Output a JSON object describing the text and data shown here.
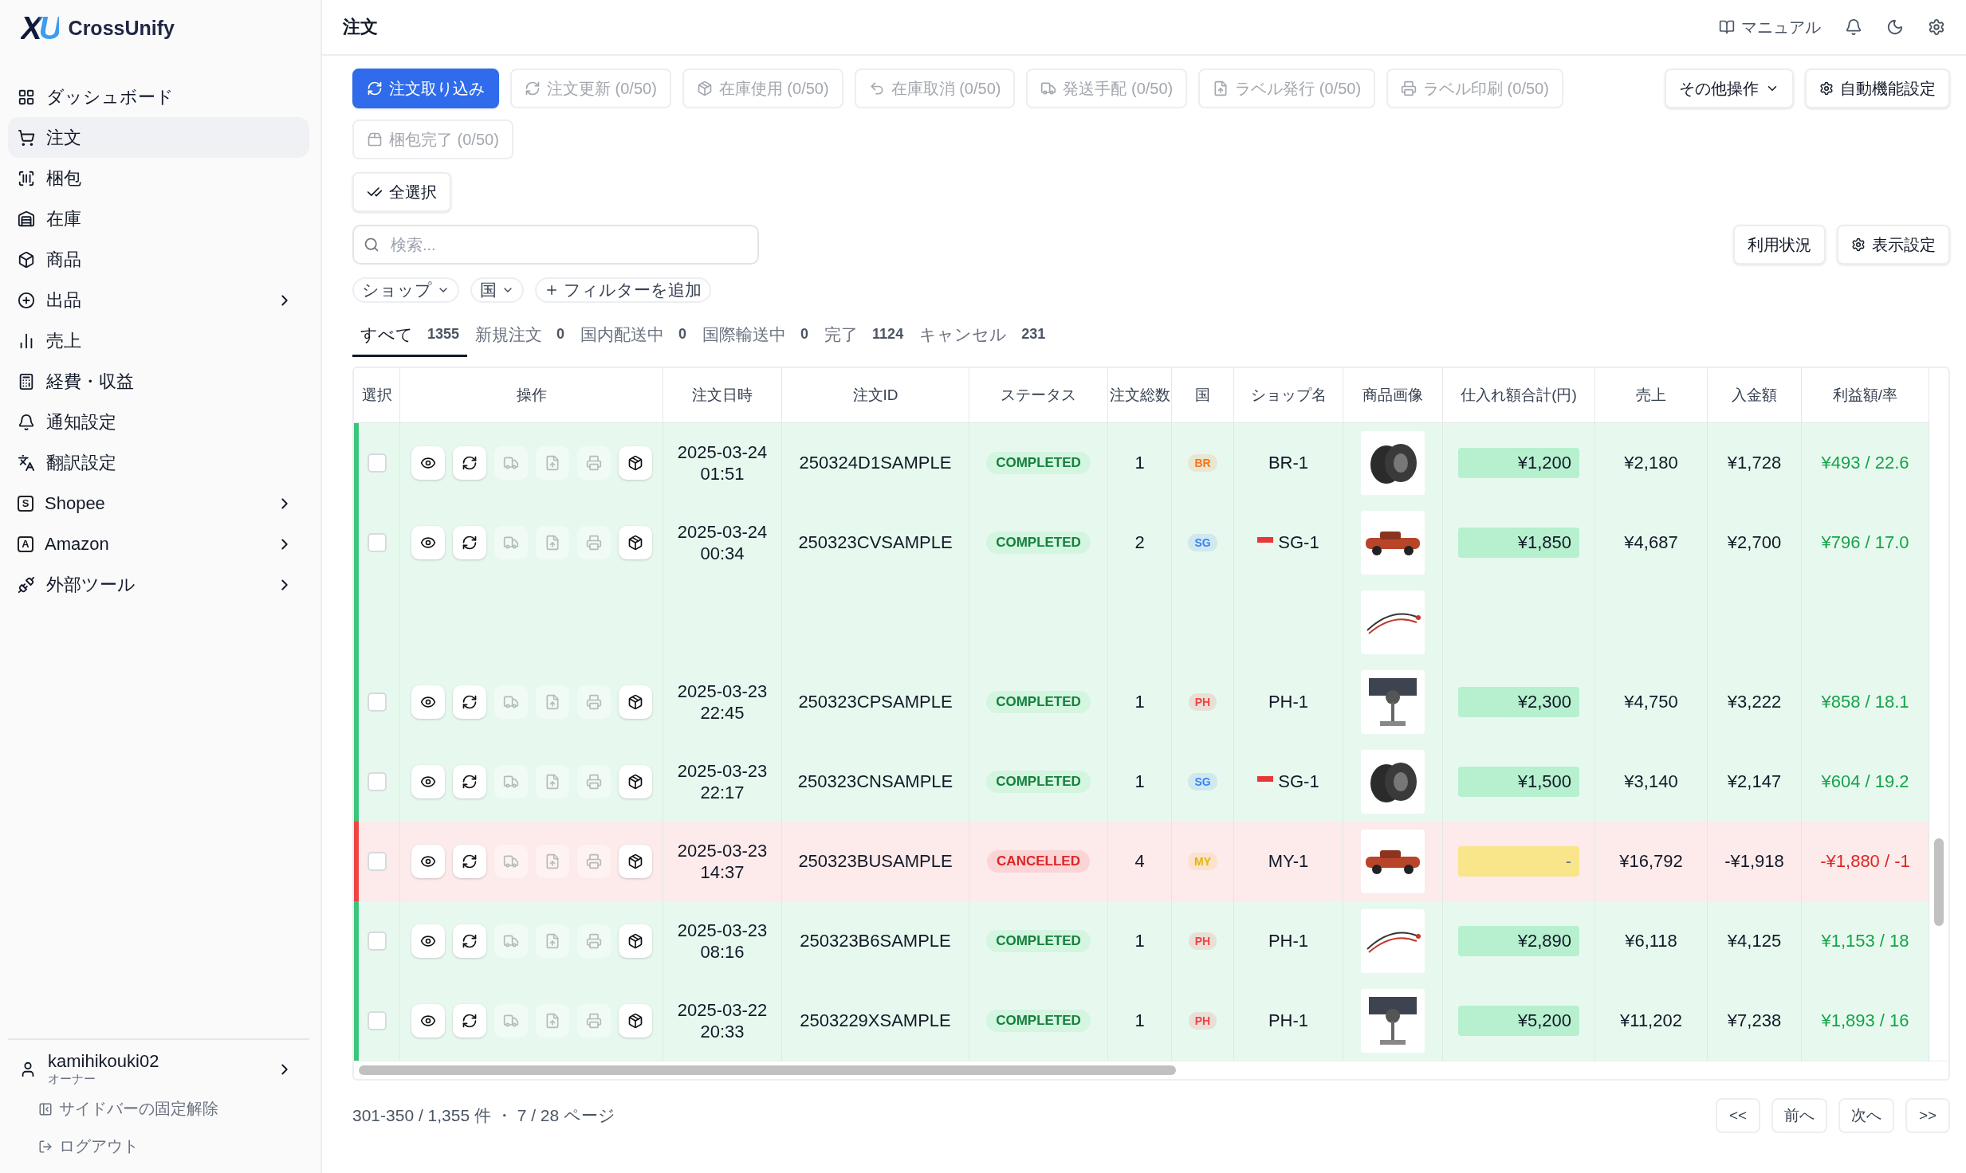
{
  "logo": {
    "mark": "XU",
    "name": "CrossUnify"
  },
  "sidebar": {
    "items": [
      {
        "label": "ダッシュボード",
        "expandable": false,
        "selected": false
      },
      {
        "label": "注文",
        "expandable": false,
        "selected": true
      },
      {
        "label": "梱包",
        "expandable": false,
        "selected": false
      },
      {
        "label": "在庫",
        "expandable": false,
        "selected": false
      },
      {
        "label": "商品",
        "expandable": false,
        "selected": false
      },
      {
        "label": "出品",
        "expandable": true,
        "selected": false
      },
      {
        "label": "売上",
        "expandable": false,
        "selected": false
      },
      {
        "label": "経費・収益",
        "expandable": false,
        "selected": false
      },
      {
        "label": "通知設定",
        "expandable": false,
        "selected": false
      },
      {
        "label": "翻訳設定",
        "expandable": false,
        "selected": false
      },
      {
        "label": "Shopee",
        "icon_letter": "S",
        "expandable": true,
        "selected": false
      },
      {
        "label": "Amazon",
        "icon_letter": "A",
        "expandable": true,
        "selected": false
      },
      {
        "label": "外部ツール",
        "expandable": true,
        "selected": false
      }
    ],
    "user": {
      "name": "kamihikouki02",
      "role": "オーナー"
    },
    "unpin": "サイドバーの固定解除",
    "logout": "ログアウト"
  },
  "header": {
    "title": "注文",
    "manual": "マニュアル"
  },
  "toolbar": [
    {
      "label": "注文取り込み",
      "kind": "primary",
      "disabled": false
    },
    {
      "label": "注文更新 (0/50)",
      "kind": "action",
      "disabled": true
    },
    {
      "label": "在庫使用 (0/50)",
      "kind": "action",
      "disabled": true
    },
    {
      "label": "在庫取消 (0/50)",
      "kind": "action",
      "disabled": true
    },
    {
      "label": "発送手配 (0/50)",
      "kind": "action",
      "disabled": true
    },
    {
      "label": "ラベル発行 (0/50)",
      "kind": "action",
      "disabled": true
    },
    {
      "label": "ラベル印刷 (0/50)",
      "kind": "action",
      "disabled": true
    },
    {
      "label": "梱包完了 (0/50)",
      "kind": "action",
      "disabled": true
    }
  ],
  "more_actions": "その他操作",
  "auto_settings": "自動機能設定",
  "select_all": "全選択",
  "search": {
    "placeholder": "検索..."
  },
  "usage": "利用状況",
  "display_settings": "表示設定",
  "filters": [
    {
      "label": "ショップ"
    },
    {
      "label": "国"
    }
  ],
  "add_filter": "フィルターを追加",
  "tabs": [
    {
      "label": "すべて",
      "count": "1355",
      "selected": true
    },
    {
      "label": "新規注文",
      "count": "0",
      "selected": false
    },
    {
      "label": "国内配送中",
      "count": "0",
      "selected": false
    },
    {
      "label": "国際輸送中",
      "count": "0",
      "selected": false
    },
    {
      "label": "完了",
      "count": "1124",
      "selected": false
    },
    {
      "label": "キャンセル",
      "count": "231",
      "selected": false
    }
  ],
  "table": {
    "columns": [
      "選択",
      "操作",
      "注文日時",
      "注文ID",
      "ステータス",
      "注文総数",
      "国",
      "ショップ名",
      "商品画像",
      "仕入れ額合計(円)",
      "売上",
      "入金額",
      "利益額/率"
    ],
    "row_actions": [
      {
        "enabled": true
      },
      {
        "enabled": true
      },
      {
        "enabled": false
      },
      {
        "enabled": false
      },
      {
        "enabled": false
      },
      {
        "enabled": true
      }
    ],
    "rows": [
      {
        "selected": false,
        "date": "2025-03-24",
        "time": "01:51",
        "id": "250324D1SAMPLE",
        "status": "COMPLETED",
        "cancelled": false,
        "qty": "1",
        "country": {
          "code": "BR",
          "color": "#f97316"
        },
        "shop": {
          "name": "BR-1",
          "flag": false
        },
        "cost": "¥1,200",
        "sales": "¥2,180",
        "deposit": "¥1,728",
        "profit": "¥493 / 22.6"
      },
      {
        "selected": false,
        "date": "2025-03-24",
        "time": "00:34",
        "id": "250323CVSAMPLE",
        "status": "COMPLETED",
        "cancelled": false,
        "qty": "2",
        "country": {
          "code": "SG",
          "color": "#3b82f6"
        },
        "shop": {
          "name": "SG-1",
          "flag": true
        },
        "cost": "¥1,850",
        "sales": "¥4,687",
        "deposit": "¥2,700",
        "profit": "¥796 / 17.0"
      },
      {
        "selected": false,
        "date": "2025-03-23",
        "time": "22:45",
        "id": "250323CPSAMPLE",
        "status": "COMPLETED",
        "cancelled": false,
        "qty": "1",
        "country": {
          "code": "PH",
          "color": "#ef4444"
        },
        "shop": {
          "name": "PH-1",
          "flag": false
        },
        "cost": "¥2,300",
        "sales": "¥4,750",
        "deposit": "¥3,222",
        "profit": "¥858 / 18.1"
      },
      {
        "selected": false,
        "date": "2025-03-23",
        "time": "22:17",
        "id": "250323CNSAMPLE",
        "status": "COMPLETED",
        "cancelled": false,
        "qty": "1",
        "country": {
          "code": "SG",
          "color": "#3b82f6"
        },
        "shop": {
          "name": "SG-1",
          "flag": true
        },
        "cost": "¥1,500",
        "sales": "¥3,140",
        "deposit": "¥2,147",
        "profit": "¥604 / 19.2"
      },
      {
        "selected": false,
        "date": "2025-03-23",
        "time": "14:37",
        "id": "250323BUSAMPLE",
        "status": "CANCELLED",
        "cancelled": true,
        "qty": "4",
        "country": {
          "code": "MY",
          "color": "#eab308"
        },
        "shop": {
          "name": "MY-1",
          "flag": false
        },
        "cost": "-",
        "sales": "¥16,792",
        "deposit": "-¥1,918",
        "profit": "-¥1,880 / -1"
      },
      {
        "selected": false,
        "date": "2025-03-23",
        "time": "08:16",
        "id": "250323B6SAMPLE",
        "status": "COMPLETED",
        "cancelled": false,
        "qty": "1",
        "country": {
          "code": "PH",
          "color": "#ef4444"
        },
        "shop": {
          "name": "PH-1",
          "flag": false
        },
        "cost": "¥2,890",
        "sales": "¥6,118",
        "deposit": "¥4,125",
        "profit": "¥1,153 / 18"
      },
      {
        "selected": false,
        "date": "2025-03-22",
        "time": "20:33",
        "id": "2503229XSAMPLE",
        "status": "COMPLETED",
        "cancelled": false,
        "qty": "1",
        "country": {
          "code": "PH",
          "color": "#ef4444"
        },
        "shop": {
          "name": "PH-1",
          "flag": false
        },
        "cost": "¥5,200",
        "sales": "¥11,202",
        "deposit": "¥7,238",
        "profit": "¥1,893 / 16"
      }
    ]
  },
  "pagination": {
    "summary": "301-350 / 1,355 件 ・ 7 / 28 ページ",
    "buttons": [
      "<<",
      "前へ",
      "次へ",
      ">>"
    ]
  }
}
